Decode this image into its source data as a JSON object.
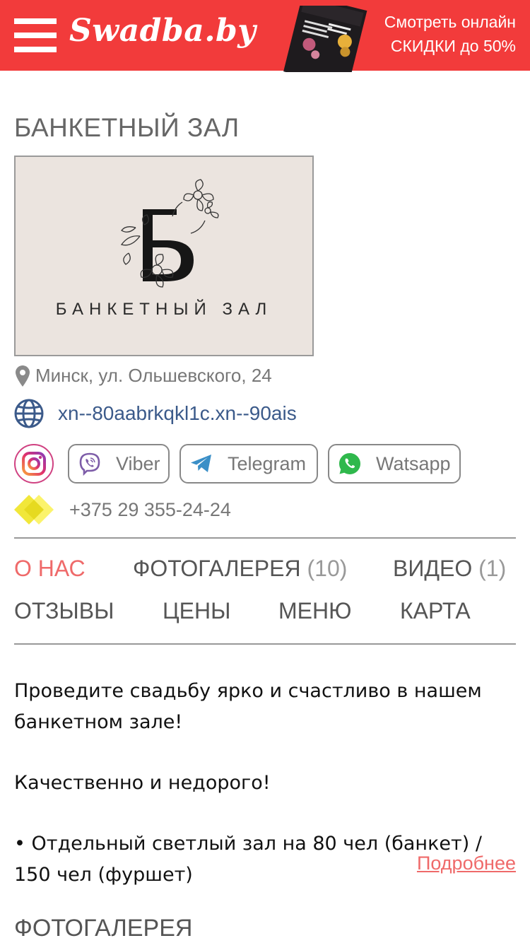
{
  "header": {
    "brand": "Swadba.by",
    "promo_line1": "Смотреть онлайн",
    "promo_line2": "СКИДКИ до 50%",
    "accent_color": "#f23b3b"
  },
  "venue": {
    "title": "БАНКЕТНЫЙ ЗАЛ",
    "logo_caption": "БАНКЕТНЫЙ ЗАЛ",
    "address": "Минск, ул. Ольшевского, 24",
    "website": "xn--80aabrkqkl1c.xn--90ais",
    "phone": "+375 29 355-24-24"
  },
  "socials": {
    "viber": "Viber",
    "telegram": "Telegram",
    "whatsapp": "Watsapp"
  },
  "tabs": [
    {
      "label": "О НАС",
      "count": ""
    },
    {
      "label": "ФОТОГАЛЕРЕЯ ",
      "count": "(10)"
    },
    {
      "label": "ВИДЕО ",
      "count": "(1)"
    },
    {
      "label": "ОТЗЫВЫ",
      "count": ""
    },
    {
      "label": "ЦЕНЫ",
      "count": ""
    },
    {
      "label": "МЕНЮ",
      "count": ""
    },
    {
      "label": "КАРТА",
      "count": ""
    }
  ],
  "description": {
    "p1": "Проведите свадьбу ярко и счастливо в нашем банкетном зале!",
    "p2": "Качественно и недорого!",
    "p3": "• Отдельный светлый зал на 80 чел (банкет) / 150 чел (фуршет)",
    "more": "Подробнее"
  },
  "gallery_title": "ФОТОГАЛЕРЕЯ"
}
